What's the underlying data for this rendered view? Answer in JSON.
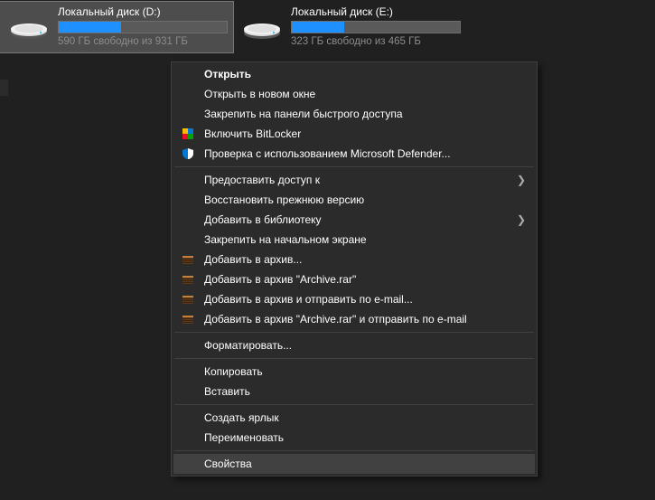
{
  "drives": [
    {
      "label": "Локальный диск (D:)",
      "free_text": "590 ГБ свободно из 931 ГБ",
      "fill_percent": 37,
      "selected": true
    },
    {
      "label": "Локальный диск (E:)",
      "free_text": "323 ГБ свободно из 465 ГБ",
      "fill_percent": 31,
      "selected": false
    }
  ],
  "menu": {
    "open": "Открыть",
    "open_new_window": "Открыть в новом окне",
    "pin_quick_access": "Закрепить на панели быстрого доступа",
    "bitlocker": "Включить BitLocker",
    "defender": "Проверка с использованием Microsoft Defender...",
    "give_access": "Предоставить доступ к",
    "restore_previous": "Восстановить прежнюю версию",
    "add_library": "Добавить в библиотеку",
    "pin_start": "Закрепить на начальном экране",
    "add_archive": "Добавить в архив...",
    "add_archive_named": "Добавить в архив \"Archive.rar\"",
    "add_archive_email": "Добавить в архив и отправить по e-mail...",
    "add_archive_named_email": "Добавить в архив \"Archive.rar\" и отправить по e-mail",
    "format": "Форматировать...",
    "copy": "Копировать",
    "paste": "Вставить",
    "create_shortcut": "Создать ярлык",
    "rename": "Переименовать",
    "properties": "Свойства"
  }
}
